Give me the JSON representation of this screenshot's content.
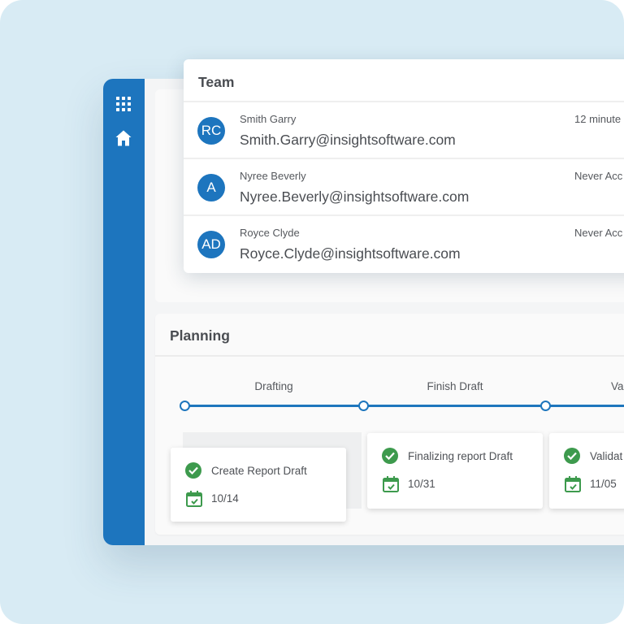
{
  "colors": {
    "background": "#d8ebf4",
    "sidebar": "#1d75be",
    "accent": "#1e76bd",
    "success": "#3d9a4d"
  },
  "sidebar": {
    "items": [
      {
        "name": "apps-grid",
        "icon": "grid-icon"
      },
      {
        "name": "home",
        "icon": "home-icon"
      }
    ]
  },
  "team": {
    "title": "Team",
    "members": [
      {
        "initials": "RC",
        "name": "Smith Garry",
        "email": "Smith.Garry@insightsoftware.com",
        "last_access": "12 minute"
      },
      {
        "initials": "A",
        "name": "Nyree Beverly",
        "email": "Nyree.Beverly@insightsoftware.com",
        "last_access": "Never Acc"
      },
      {
        "initials": "AD",
        "name": "Royce Clyde",
        "email": "Royce.Clyde@insightsoftware.com",
        "last_access": "Never Acc"
      }
    ]
  },
  "planning": {
    "title": "Planning",
    "stages": [
      {
        "label": "Drafting",
        "task": {
          "title": "Create Report Draft",
          "date": "10/14",
          "status": "complete"
        }
      },
      {
        "label": "Finish Draft",
        "task": {
          "title": "Finalizing report Draft",
          "date": "10/31",
          "status": "complete"
        }
      },
      {
        "label": "Va",
        "task": {
          "title": "Validat",
          "date": "11/05",
          "status": "complete"
        }
      }
    ]
  }
}
